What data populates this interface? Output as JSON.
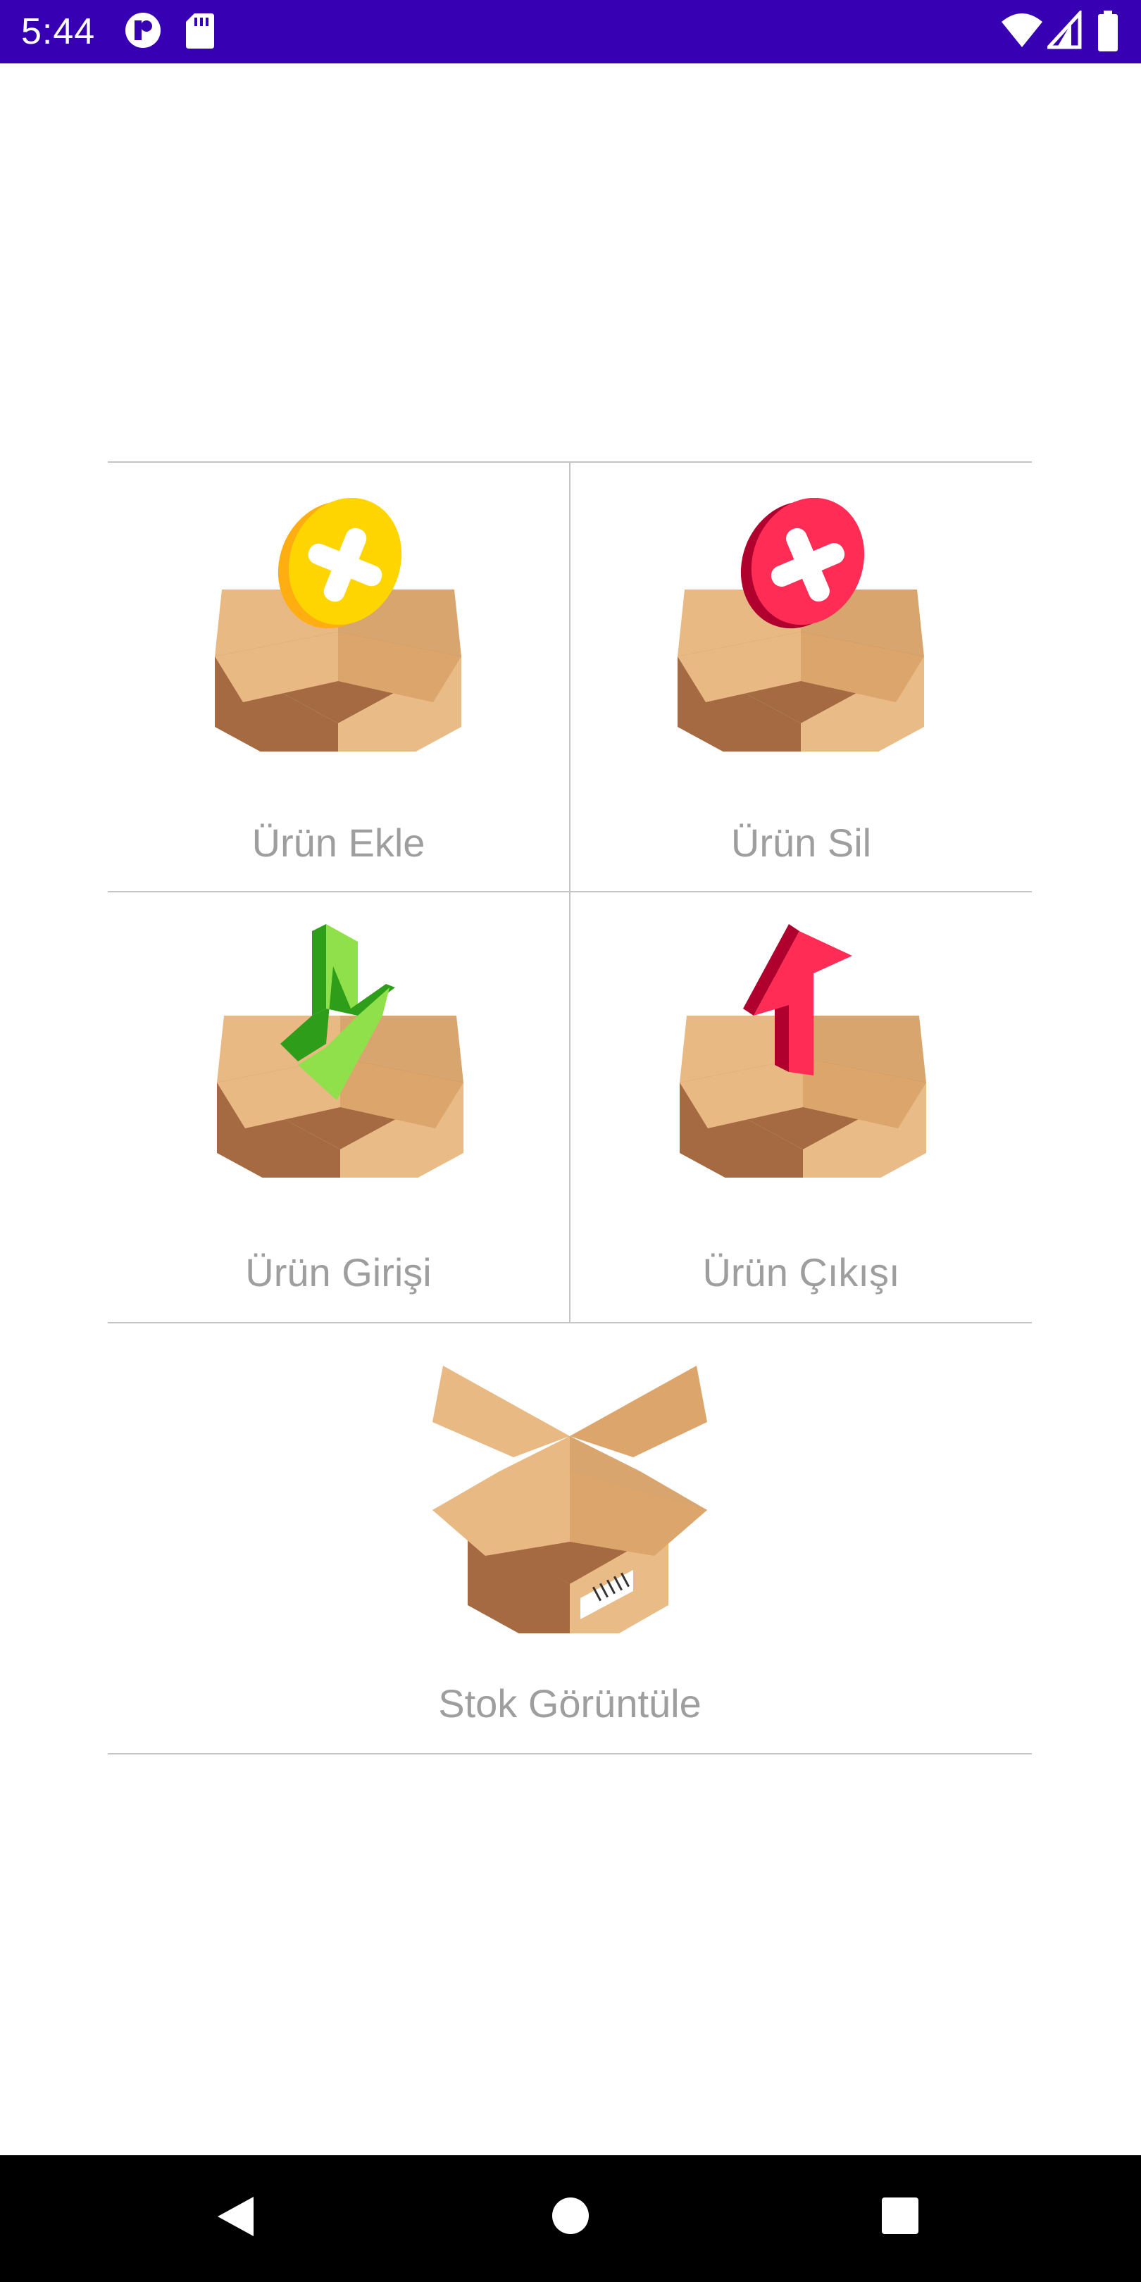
{
  "status_bar": {
    "time": "5:44",
    "icons": [
      "app-notification-icon",
      "sd-card-icon",
      "wifi-icon",
      "cell-signal-icon",
      "battery-icon"
    ],
    "background": "#3700b3"
  },
  "menu": {
    "items": [
      {
        "label": "Ürün Ekle",
        "icon": "box-add-icon",
        "accent": "#ffd400"
      },
      {
        "label": "Ürün Sil",
        "icon": "box-delete-icon",
        "accent": "#ff2d55"
      },
      {
        "label": "Ürün Girişi",
        "icon": "box-in-icon",
        "accent": "#8fe04a"
      },
      {
        "label": "Ürün Çıkışı",
        "icon": "box-out-icon",
        "accent": "#ff2d55"
      },
      {
        "label": "Stok Görüntüle",
        "icon": "box-stock-icon",
        "accent": "#dca56c"
      }
    ]
  },
  "nav_bar": {
    "buttons": [
      "back-icon",
      "home-icon",
      "recents-icon"
    ]
  }
}
